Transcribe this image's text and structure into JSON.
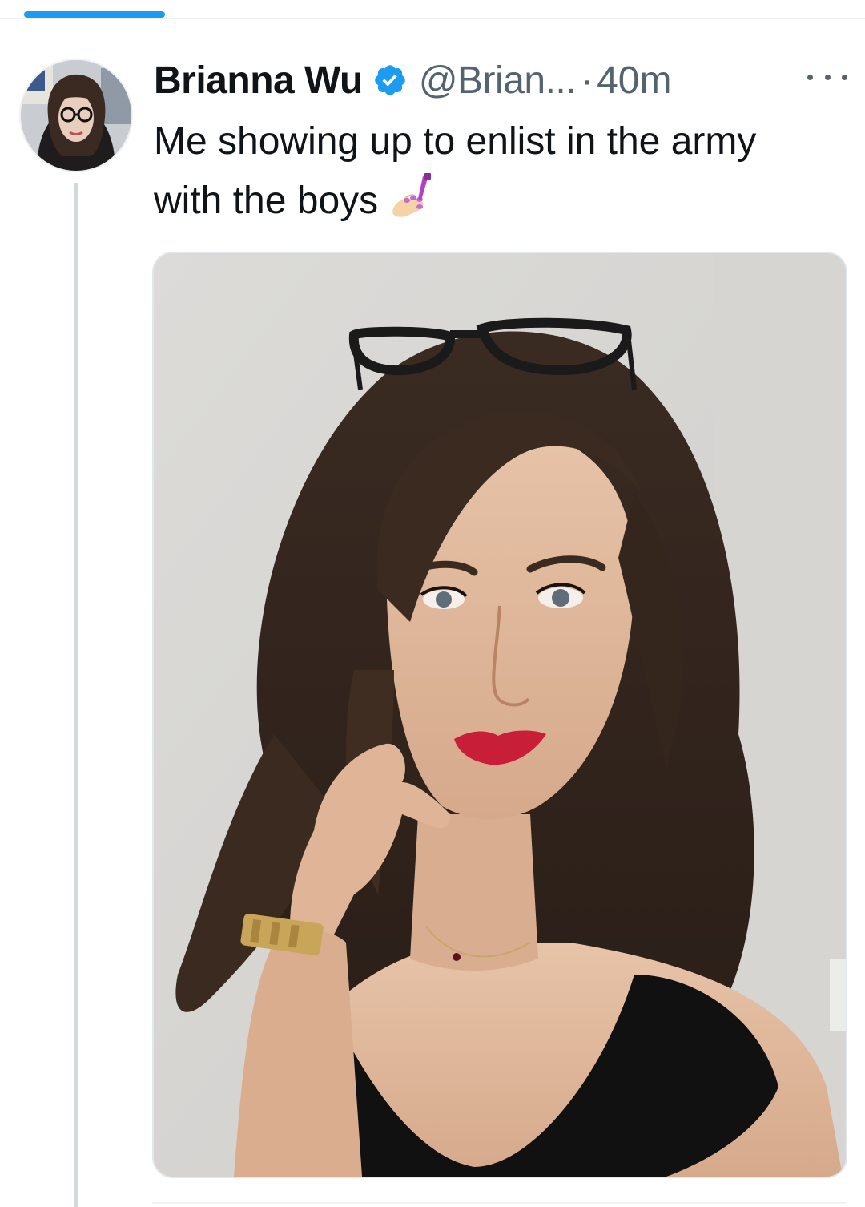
{
  "tweet": {
    "display_name": "Brianna Wu",
    "verified": true,
    "handle": "@Brian...",
    "separator": "·",
    "time": "40m",
    "text": "Me showing up to enlist in the army with the boys",
    "emoji": "nail-polish",
    "media": {
      "type": "photo"
    }
  },
  "icons": {
    "verified": "verified-badge-icon",
    "more": "more-options-icon",
    "emoji": "nail-polish-emoji-icon"
  },
  "colors": {
    "accent": "#1d9bf0",
    "text_primary": "#0f1419",
    "text_secondary": "#536471",
    "thread_line": "#cfd9de"
  }
}
